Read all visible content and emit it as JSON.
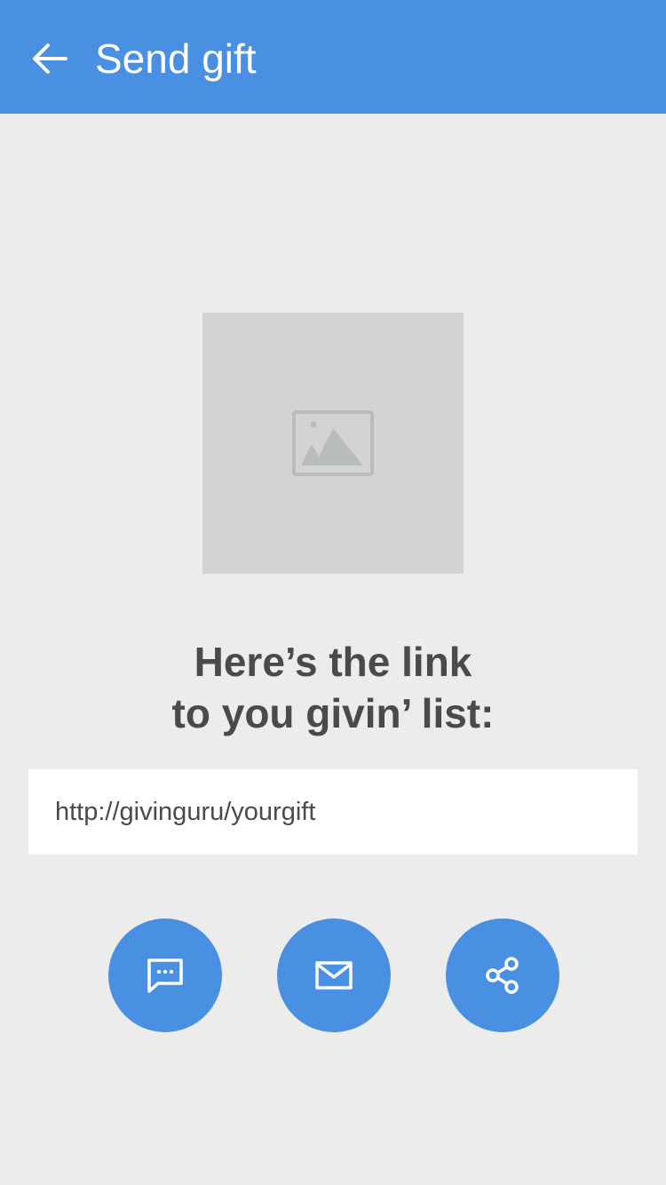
{
  "app_bar": {
    "title": "Send gift",
    "back_icon": "arrow-left-icon",
    "color": "#4a90e2"
  },
  "image": {
    "icon": "image-placeholder-icon"
  },
  "heading": {
    "line1": "Here’s the link",
    "line2": "to you givin’ list:"
  },
  "link": {
    "value": "http://givinguru/yourgift"
  },
  "actions": [
    {
      "icon": "message-icon"
    },
    {
      "icon": "email-icon"
    },
    {
      "icon": "share-icon"
    }
  ],
  "colors": {
    "accent": "#4a90e2",
    "background": "#ececec",
    "text": "#4a4a4a"
  }
}
